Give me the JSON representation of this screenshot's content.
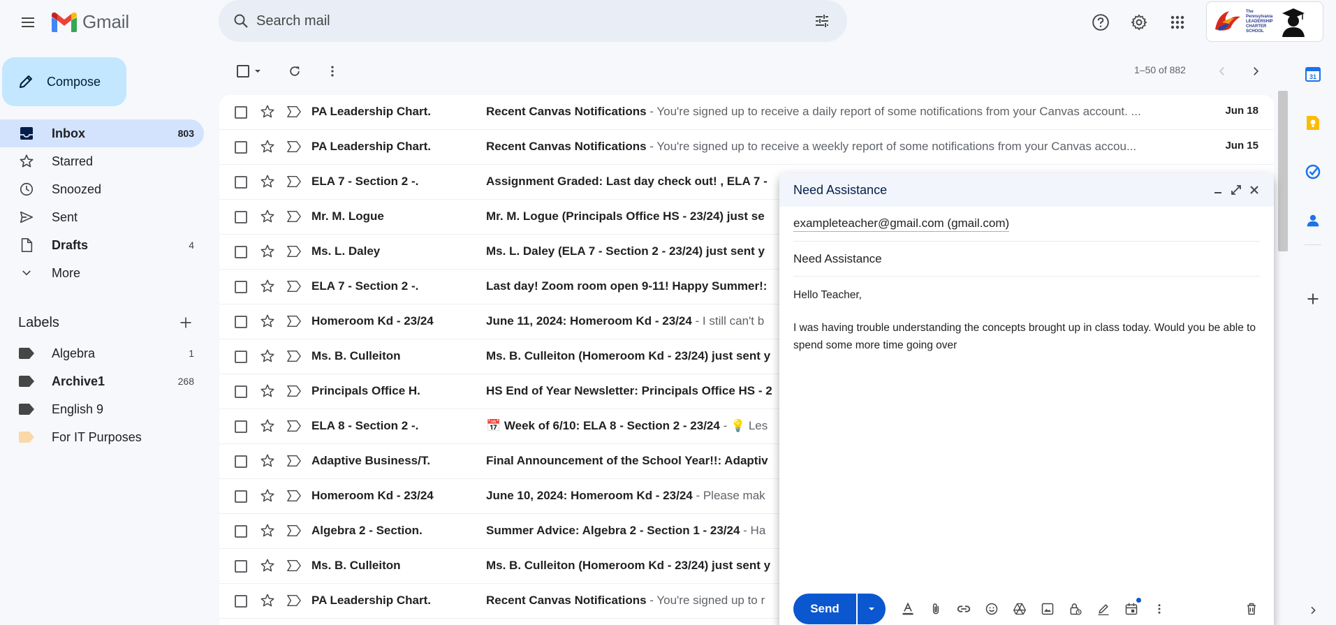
{
  "app": {
    "logo_text": "Gmail"
  },
  "search": {
    "placeholder": "Search mail"
  },
  "account": {
    "org_text": "The Pennsylvania LEADERSHIP CHARTER SCHOOL"
  },
  "sidebar": {
    "compose_label": "Compose",
    "items": [
      {
        "label": "Inbox",
        "count": "803"
      },
      {
        "label": "Starred",
        "count": ""
      },
      {
        "label": "Snoozed",
        "count": ""
      },
      {
        "label": "Sent",
        "count": ""
      },
      {
        "label": "Drafts",
        "count": "4"
      },
      {
        "label": "More",
        "count": ""
      }
    ],
    "labels_title": "Labels",
    "labels": [
      {
        "label": "Algebra",
        "count": "1",
        "color": "#444746"
      },
      {
        "label": "Archive1",
        "count": "268",
        "color": "#444746"
      },
      {
        "label": "English 9",
        "count": "",
        "color": "#444746"
      },
      {
        "label": "For IT Purposes",
        "count": "",
        "color": "#fad8a8"
      }
    ]
  },
  "toolbar": {
    "pager": "1–50 of 882"
  },
  "emails": [
    {
      "sender": "PA Leadership Chart.",
      "subject": "Recent Canvas Notifications",
      "snippet": " - You're signed up to receive a daily report of some notifications from your Canvas account. ...",
      "date": "Jun 18"
    },
    {
      "sender": "PA Leadership Chart.",
      "subject": "Recent Canvas Notifications",
      "snippet": " - You're signed up to receive a weekly report of some notifications from your Canvas accou...",
      "date": "Jun 15"
    },
    {
      "sender": "ELA 7 - Section 2 -.",
      "subject": "Assignment Graded: Last day check out! , ELA 7 -",
      "snippet": "",
      "date": ""
    },
    {
      "sender": "Mr. M. Logue",
      "subject": "Mr. M. Logue (Principals Office HS - 23/24) just se",
      "snippet": "",
      "date": ""
    },
    {
      "sender": "Ms. L. Daley",
      "subject": "Ms. L. Daley (ELA 7 - Section 2 - 23/24) just sent y",
      "snippet": "",
      "date": ""
    },
    {
      "sender": "ELA 7 - Section 2 -.",
      "subject": "Last day! Zoom room open 9-11! Happy Summer!: ",
      "snippet": "",
      "date": ""
    },
    {
      "sender": "Homeroom Kd - 23/24",
      "subject": "June 11, 2024: Homeroom Kd - 23/24",
      "snippet": " - I still can't b",
      "date": ""
    },
    {
      "sender": "Ms. B. Culleiton",
      "subject": "Ms. B. Culleiton (Homeroom Kd - 23/24) just sent y",
      "snippet": "",
      "date": ""
    },
    {
      "sender": "Principals Office H.",
      "subject": "HS End of Year Newsletter: Principals Office HS - 2",
      "snippet": "",
      "date": ""
    },
    {
      "sender": "ELA 8 - Section 2 -.",
      "subject": "📅 Week of 6/10: ELA 8 - Section 2 - 23/24",
      "snippet": " - 💡 Les",
      "date": ""
    },
    {
      "sender": "Adaptive Business/T.",
      "subject": "Final Announcement of the School Year!!: Adaptiv",
      "snippet": "",
      "date": ""
    },
    {
      "sender": "Homeroom Kd - 23/24",
      "subject": "June 10, 2024: Homeroom Kd - 23/24",
      "snippet": " - Please mak",
      "date": ""
    },
    {
      "sender": "Algebra 2 - Section.",
      "subject": "Summer Advice: Algebra 2 - Section 1 - 23/24",
      "snippet": " - Ha",
      "date": ""
    },
    {
      "sender": "Ms. B. Culleiton",
      "subject": "Ms. B. Culleiton (Homeroom Kd - 23/24) just sent y",
      "snippet": "",
      "date": ""
    },
    {
      "sender": "PA Leadership Chart.",
      "subject": "Recent Canvas Notifications",
      "snippet": " - You're signed up to r",
      "date": ""
    }
  ],
  "compose": {
    "title": "Need Assistance",
    "recipient": "exampleteacher@gmail.com (gmail.com)",
    "subject": "Need Assistance",
    "greeting": "Hello Teacher,",
    "body": "I was having trouble understanding the concepts brought up in class today. Would you be able to spend some more time going over",
    "send_label": "Send"
  },
  "colors": {
    "accent": "#0b57d0",
    "compose_bg": "#c2e7ff",
    "nav_active": "#d3e3fd"
  }
}
